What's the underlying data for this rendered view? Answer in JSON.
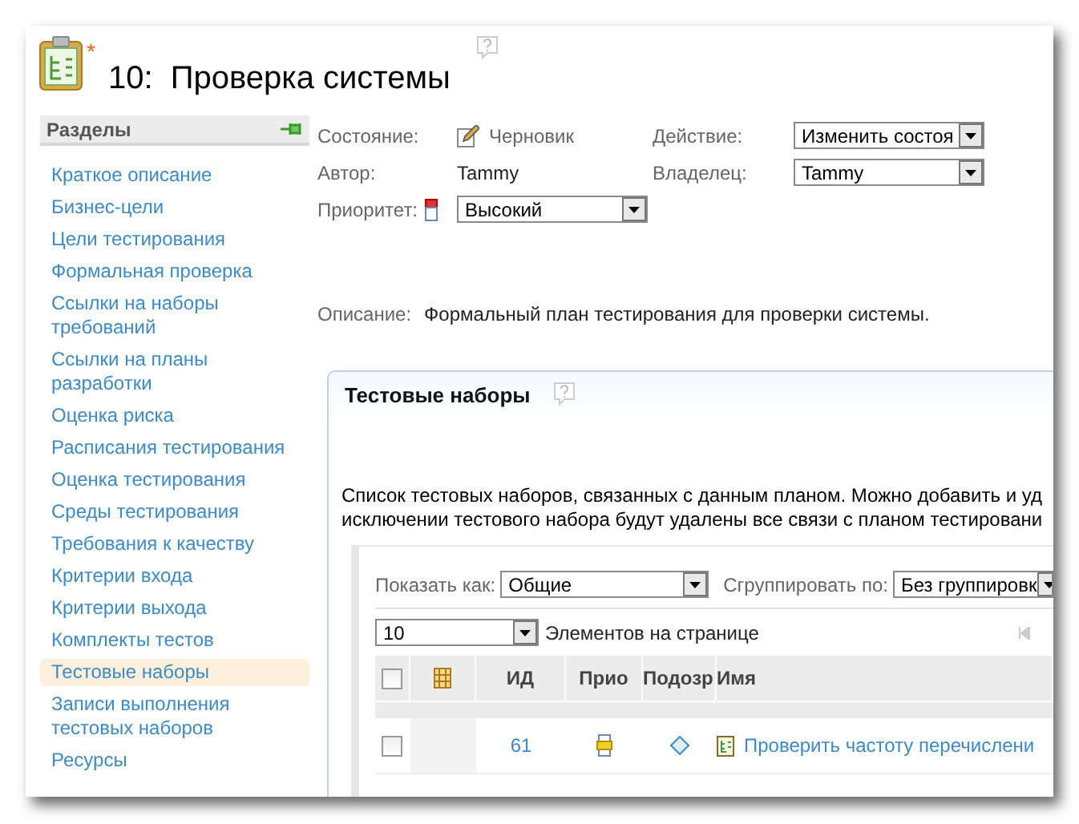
{
  "header": {
    "title": "10:  Проверка системы",
    "modified_mark": "*"
  },
  "sidebar": {
    "title": "Разделы",
    "items": [
      {
        "label": "Краткое описание",
        "selected": false
      },
      {
        "label": "Бизнес-цели",
        "selected": false
      },
      {
        "label": "Цели тестирования",
        "selected": false
      },
      {
        "label": "Формальная проверка",
        "selected": false
      },
      {
        "label": "Ссылки на наборы требований",
        "selected": false
      },
      {
        "label": "Ссылки на планы разработки",
        "selected": false
      },
      {
        "label": "Оценка риска",
        "selected": false
      },
      {
        "label": "Расписания тестирования",
        "selected": false
      },
      {
        "label": "Оценка тестирования",
        "selected": false
      },
      {
        "label": "Среды тестирования",
        "selected": false
      },
      {
        "label": "Требования к качеству",
        "selected": false
      },
      {
        "label": "Критерии входа",
        "selected": false
      },
      {
        "label": "Критерии выхода",
        "selected": false
      },
      {
        "label": "Комплекты тестов",
        "selected": false
      },
      {
        "label": "Тестовые наборы",
        "selected": true
      },
      {
        "label": "Записи выполнения тестовых наборов",
        "selected": false
      },
      {
        "label": "Ресурсы",
        "selected": false
      }
    ]
  },
  "fields": {
    "state": {
      "label": "Состояние:",
      "value": "Черновик"
    },
    "action": {
      "label": "Действие:",
      "value": "Изменить состоя"
    },
    "author": {
      "label": "Автор:",
      "value": "Tammy"
    },
    "owner": {
      "label": "Владелец:",
      "value": "Tammy"
    },
    "priority": {
      "label": "Приоритет:",
      "value": "Высокий"
    },
    "description": {
      "label": "Описание:",
      "value": "Формальный план тестирования для проверки системы."
    }
  },
  "panel": {
    "title": "Тестовые наборы",
    "text": [
      "Список тестовых наборов, связанных с данным планом. Можно добавить и уд",
      "исключении тестового набора будут удалены все связи с планом тестировани"
    ],
    "show_as": {
      "label": "Показать как:",
      "value": "Общие"
    },
    "group_by": {
      "label": "Сгруппировать по:",
      "value": "Без группировк"
    },
    "page_size": {
      "value": "10",
      "label": "Элементов на странице"
    },
    "table": {
      "header_checked": false,
      "columns": [
        "ИД",
        "Прио",
        "Подозр",
        "Имя"
      ],
      "rows": [
        {
          "checked": false,
          "id": "61",
          "name": "Проверить частоту перечислени"
        }
      ]
    }
  }
}
